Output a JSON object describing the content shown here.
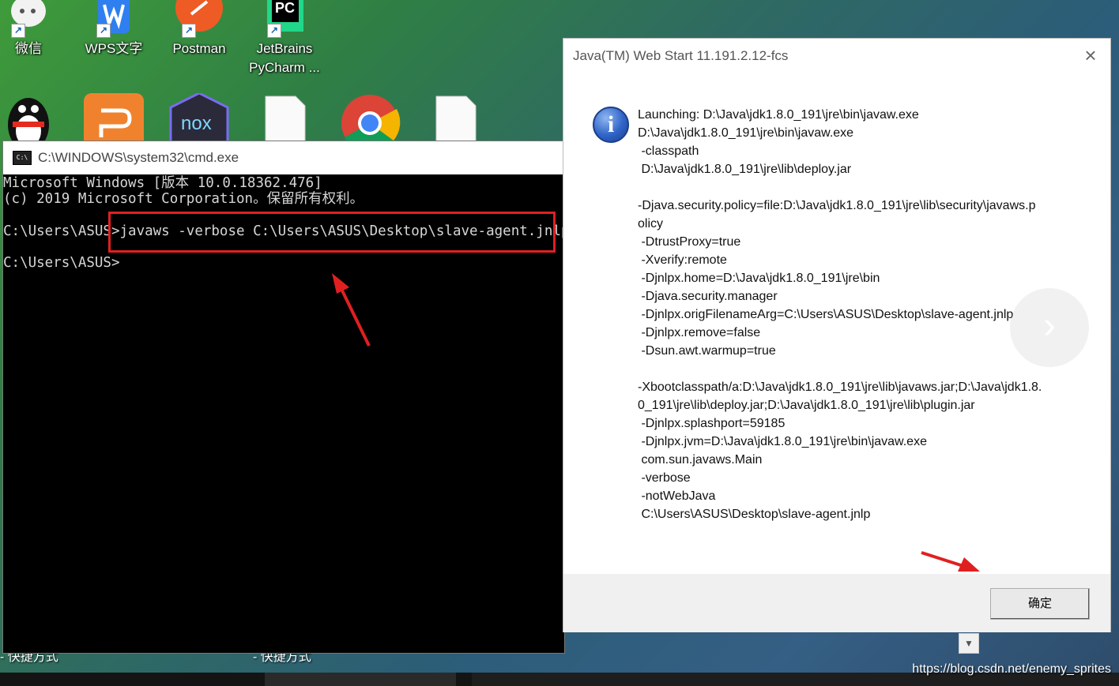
{
  "desktop": {
    "icons_row1": [
      {
        "label": "微信",
        "icon": "wechat-icon"
      },
      {
        "label": "WPS文字",
        "icon": "wps-writer-icon"
      },
      {
        "label": "Postman",
        "icon": "postman-icon"
      },
      {
        "label": "JetBrains\nPyCharm ...",
        "icon": "pycharm-icon"
      }
    ],
    "icons_row2": [
      {
        "icon": "qq-icon"
      },
      {
        "icon": "wps-presentation-icon"
      },
      {
        "icon": "nox-icon"
      },
      {
        "icon": "file-icon"
      },
      {
        "icon": "chrome-icon"
      },
      {
        "icon": "file-icon"
      }
    ],
    "behind_label_1": "- 快捷方式",
    "behind_label_2": "- 快捷方式"
  },
  "cmd": {
    "title": "C:\\WINDOWS\\system32\\cmd.exe",
    "lines": [
      "Microsoft Windows [版本 10.0.18362.476]",
      "(c) 2019 Microsoft Corporation。保留所有权利。",
      "C:\\Users\\ASUS>javaws -verbose C:\\Users\\ASUS\\Desktop\\slave-agent.jnlp",
      "C:\\Users\\ASUS>"
    ]
  },
  "dialog": {
    "title": "Java(TM) Web Start 11.191.2.12-fcs",
    "message_lines": [
      "Launching: D:\\Java\\jdk1.8.0_191\\jre\\bin\\javaw.exe",
      "D:\\Java\\jdk1.8.0_191\\jre\\bin\\javaw.exe",
      " -classpath",
      " D:\\Java\\jdk1.8.0_191\\jre\\lib\\deploy.jar",
      "",
      "-Djava.security.policy=file:D:\\Java\\jdk1.8.0_191\\jre\\lib\\security\\javaws.p",
      "olicy",
      " -DtrustProxy=true",
      " -Xverify:remote",
      " -Djnlpx.home=D:\\Java\\jdk1.8.0_191\\jre\\bin",
      " -Djava.security.manager",
      " -Djnlpx.origFilenameArg=C:\\Users\\ASUS\\Desktop\\slave-agent.jnlp",
      " -Djnlpx.remove=false",
      " -Dsun.awt.warmup=true",
      "",
      "-Xbootclasspath/a:D:\\Java\\jdk1.8.0_191\\jre\\lib\\javaws.jar;D:\\Java\\jdk1.8.",
      "0_191\\jre\\lib\\deploy.jar;D:\\Java\\jdk1.8.0_191\\jre\\lib\\plugin.jar",
      " -Djnlpx.splashport=59185",
      " -Djnlpx.jvm=D:\\Java\\jdk1.8.0_191\\jre\\bin\\javaw.exe",
      " com.sun.javaws.Main",
      " -verbose",
      " -notWebJava",
      " C:\\Users\\ASUS\\Desktop\\slave-agent.jnlp"
    ],
    "ok_label": "确定"
  },
  "watermark": "https://blog.csdn.net/enemy_sprites",
  "colors": {
    "highlight": "#e02020",
    "arrow": "#e02020"
  }
}
